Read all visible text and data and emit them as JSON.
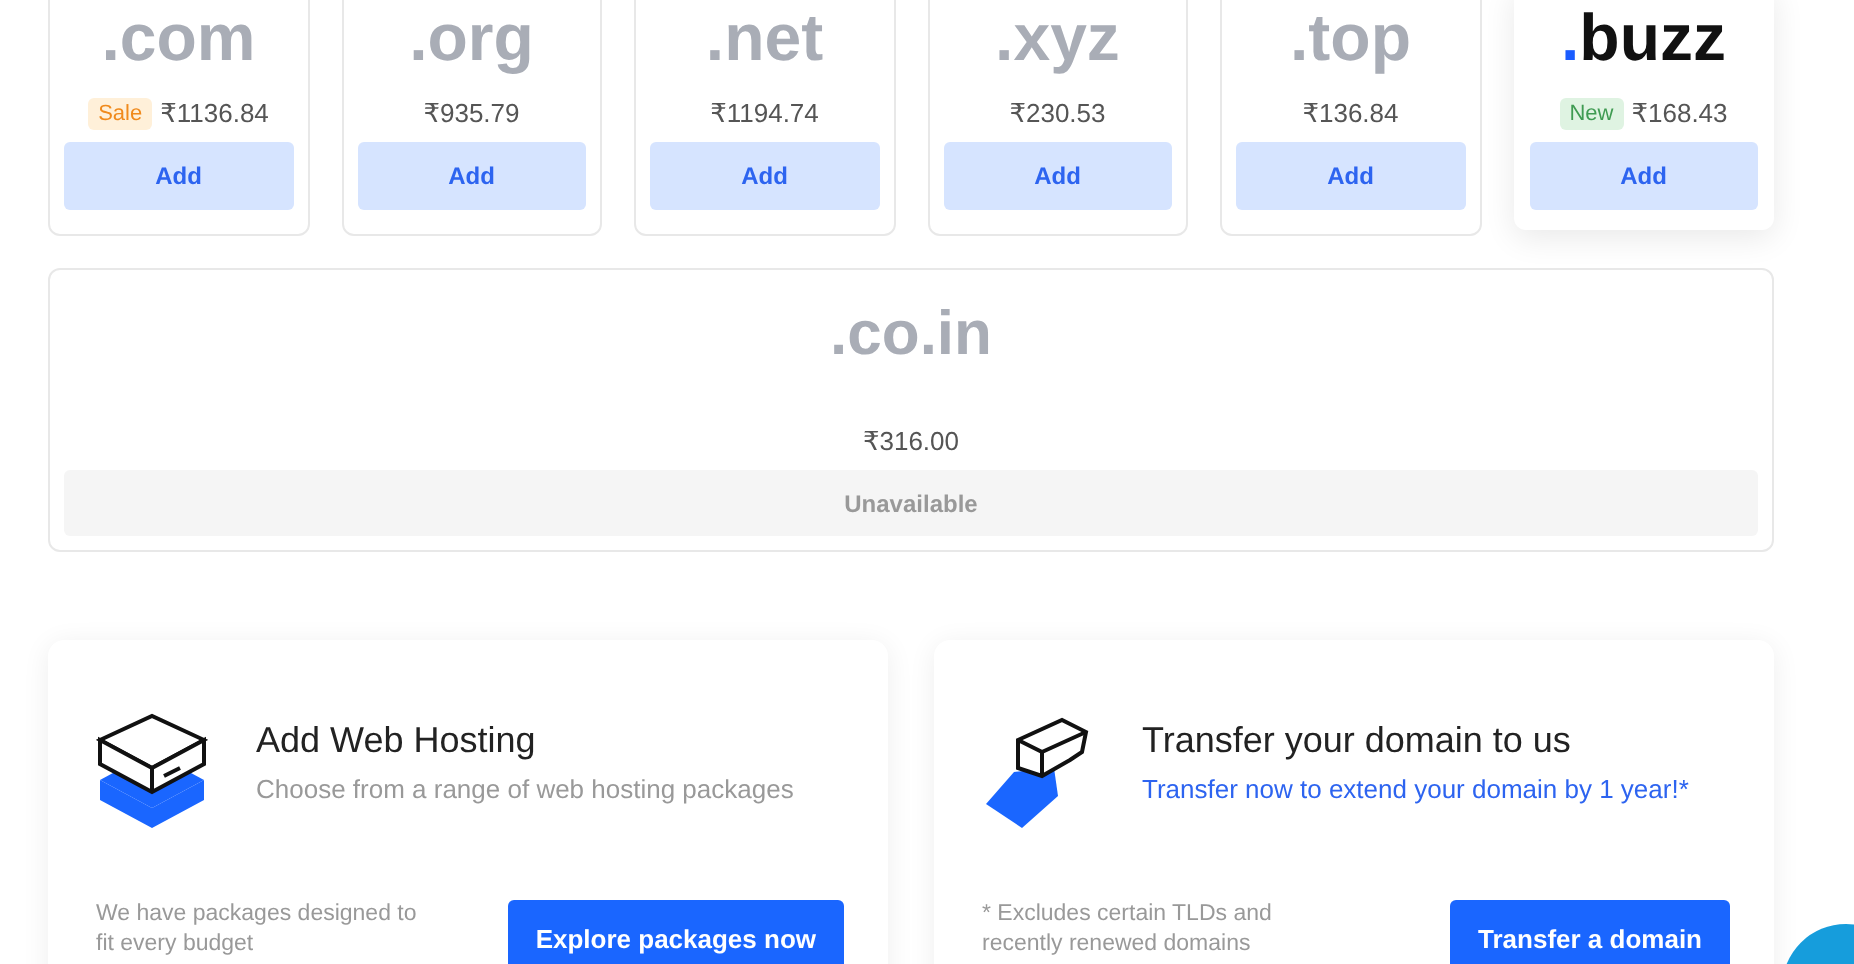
{
  "domains": [
    {
      "dot": ".",
      "name": "com",
      "badge": {
        "text": "Sale",
        "kind": "sale"
      },
      "price": "₹1136.84",
      "button": "Add",
      "selected": false
    },
    {
      "dot": ".",
      "name": "org",
      "price": "₹935.79",
      "button": "Add",
      "selected": false
    },
    {
      "dot": ".",
      "name": "net",
      "price": "₹1194.74",
      "button": "Add",
      "selected": false
    },
    {
      "dot": ".",
      "name": "xyz",
      "price": "₹230.53",
      "button": "Add",
      "selected": false
    },
    {
      "dot": ".",
      "name": "top",
      "price": "₹136.84",
      "button": "Add",
      "selected": false
    },
    {
      "dot": ".",
      "name": "buzz",
      "badge": {
        "text": "New",
        "kind": "new"
      },
      "price": "₹168.43",
      "button": "Add",
      "selected": true
    }
  ],
  "unavailable_domain": {
    "dot": ".",
    "name": "co.in",
    "price": "₹316.00",
    "status": "Unavailable"
  },
  "offers": [
    {
      "kind": "hosting",
      "title": "Add Web Hosting",
      "subtitle": "Choose from a range of web hosting packages",
      "note": "We have packages designed to fit every budget",
      "button": "Explore packages now"
    },
    {
      "kind": "transfer",
      "title": "Transfer your domain to us",
      "subtitle": "Transfer now to extend your domain by 1 year!*",
      "note": "* Excludes certain TLDs and recently renewed domains",
      "button": "Transfer a domain"
    }
  ]
}
